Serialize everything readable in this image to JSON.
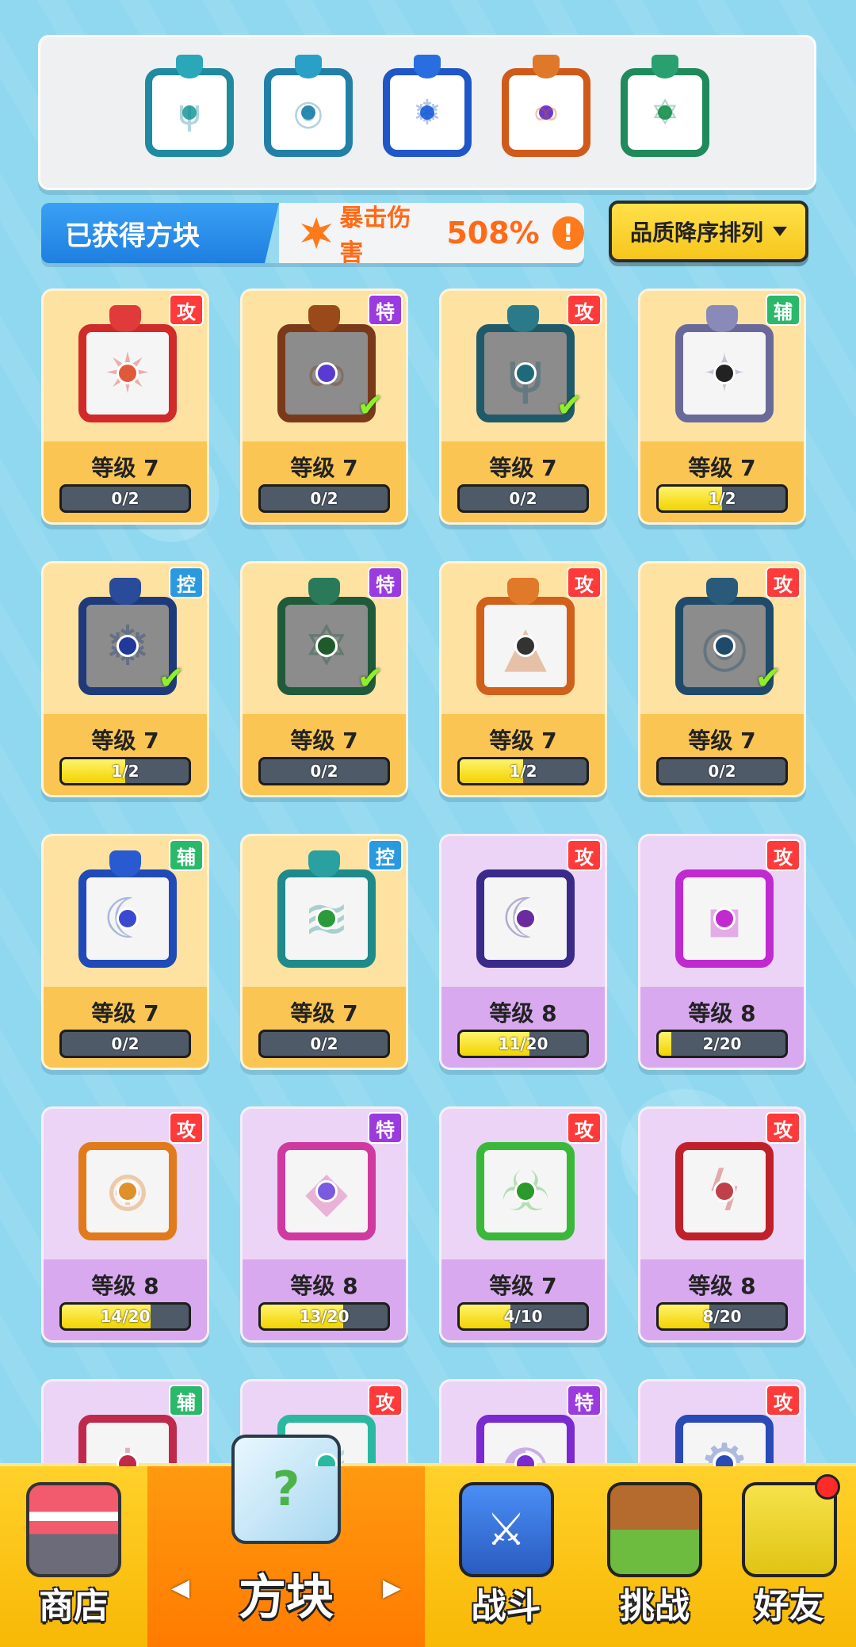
{
  "equipped": [
    {
      "icon": "trident-block-icon",
      "frame": "#1f8aa0",
      "crest": "#2aa7b8",
      "core": "#3aa7a7",
      "glyph": "ψ"
    },
    {
      "icon": "vortex-block-icon",
      "frame": "#2280a8",
      "crest": "#2aa0c8",
      "core": "#2a8ab0",
      "glyph": "◎"
    },
    {
      "icon": "snowflake-block-icon",
      "frame": "#1f56c8",
      "crest": "#2a6de0",
      "core": "#2a6de0",
      "glyph": "❄"
    },
    {
      "icon": "infinity-block-icon",
      "frame": "#d05a1a",
      "crest": "#e0782a",
      "core": "#6a3ad0",
      "glyph": "∞"
    },
    {
      "icon": "pentagram-block-icon",
      "frame": "#1f8a5a",
      "crest": "#2aa070",
      "core": "#2a9a5a",
      "glyph": "✡"
    }
  ],
  "info": {
    "label": "已获得方块",
    "crit_label": "暴击伤害",
    "crit_value": "508%",
    "alert": "!"
  },
  "sort": {
    "label": "品质降序排列"
  },
  "cards": [
    {
      "tier": "gold",
      "badge": "攻",
      "badge_color": "#ff3a3a",
      "frame": "#d02a2a",
      "crest": "#e03a3a",
      "core": "#e05a3a",
      "glyph": "✷",
      "dim": false,
      "check": false,
      "level": "等级 7",
      "progress": "0/2",
      "fill": 0
    },
    {
      "tier": "gold",
      "badge": "特",
      "badge_color": "#9a3adf",
      "frame": "#7a3a1a",
      "crest": "#9a4a1a",
      "core": "#5a3ad0",
      "glyph": "∞",
      "dim": true,
      "check": true,
      "level": "等级 7",
      "progress": "0/2",
      "fill": 0
    },
    {
      "tier": "gold",
      "badge": "攻",
      "badge_color": "#ff3a3a",
      "frame": "#1f5a6a",
      "crest": "#2a7a8a",
      "core": "#1f6a7a",
      "glyph": "ψ",
      "dim": true,
      "check": true,
      "level": "等级 7",
      "progress": "0/2",
      "fill": 0
    },
    {
      "tier": "gold",
      "badge": "辅",
      "badge_color": "#2ab86a",
      "frame": "#6a6a9a",
      "crest": "#8a8ab8",
      "core": "#222",
      "glyph": "✦",
      "dim": false,
      "check": false,
      "level": "等级 7",
      "progress": "1/2",
      "fill": 0.5
    },
    {
      "tier": "gold",
      "badge": "控",
      "badge_color": "#2a9ae0",
      "frame": "#1f3a7a",
      "crest": "#2a4a9a",
      "core": "#1f3a9a",
      "glyph": "❄",
      "dim": true,
      "check": true,
      "level": "等级 7",
      "progress": "1/2",
      "fill": 0.5
    },
    {
      "tier": "gold",
      "badge": "特",
      "badge_color": "#9a3adf",
      "frame": "#1f5a3a",
      "crest": "#2a7a5a",
      "core": "#1f5a2a",
      "glyph": "✡",
      "dim": true,
      "check": true,
      "level": "等级 7",
      "progress": "0/2",
      "fill": 0
    },
    {
      "tier": "gold",
      "badge": "攻",
      "badge_color": "#ff3a3a",
      "frame": "#d0601a",
      "crest": "#e07a2a",
      "core": "#333",
      "glyph": "▲",
      "dim": false,
      "check": false,
      "level": "等级 7",
      "progress": "1/2",
      "fill": 0.5
    },
    {
      "tier": "gold",
      "badge": "攻",
      "badge_color": "#ff3a3a",
      "frame": "#1f4a6a",
      "crest": "#2a5a7a",
      "core": "#1f4a6a",
      "glyph": "◎",
      "dim": true,
      "check": true,
      "level": "等级 7",
      "progress": "0/2",
      "fill": 0
    },
    {
      "tier": "gold",
      "badge": "辅",
      "badge_color": "#2ab86a",
      "frame": "#1f4ab8",
      "crest": "#2a5ad0",
      "core": "#3a4ad0",
      "glyph": "☾",
      "dim": false,
      "check": false,
      "level": "等级 7",
      "progress": "0/2",
      "fill": 0
    },
    {
      "tier": "gold",
      "badge": "控",
      "badge_color": "#2a9ae0",
      "frame": "#1f8a8a",
      "crest": "#2aa0a0",
      "core": "#2a9a3a",
      "glyph": "≋",
      "dim": false,
      "check": false,
      "level": "等级 7",
      "progress": "0/2",
      "fill": 0
    },
    {
      "tier": "purple",
      "badge": "攻",
      "badge_color": "#ff3a3a",
      "frame": "#3a2a8a",
      "crest": "",
      "core": "#6a2aa0",
      "glyph": "☾",
      "dim": false,
      "check": false,
      "level": "等级 8",
      "progress": "11/20",
      "fill": 0.55
    },
    {
      "tier": "purple",
      "badge": "攻",
      "badge_color": "#ff3a3a",
      "frame": "#c02ad0",
      "crest": "",
      "core": "#c02ad0",
      "glyph": "▪",
      "dim": false,
      "check": false,
      "level": "等级 8",
      "progress": "2/20",
      "fill": 0.1
    },
    {
      "tier": "purple",
      "badge": "攻",
      "badge_color": "#ff3a3a",
      "frame": "#e07a1a",
      "crest": "",
      "core": "#e0902a",
      "glyph": "⊕",
      "dim": false,
      "check": false,
      "level": "等级 8",
      "progress": "14/20",
      "fill": 0.7
    },
    {
      "tier": "purple",
      "badge": "特",
      "badge_color": "#9a3adf",
      "frame": "#d03aa0",
      "crest": "",
      "core": "#7a5ae0",
      "glyph": "◆",
      "dim": false,
      "check": false,
      "level": "等级 8",
      "progress": "13/20",
      "fill": 0.65
    },
    {
      "tier": "purple",
      "badge": "攻",
      "badge_color": "#ff3a3a",
      "frame": "#3ab83a",
      "crest": "",
      "core": "#2a9a2a",
      "glyph": "☣",
      "dim": false,
      "check": false,
      "level": "等级 7",
      "progress": "4/10",
      "fill": 0.4
    },
    {
      "tier": "purple",
      "badge": "攻",
      "badge_color": "#ff3a3a",
      "frame": "#c0202a",
      "crest": "",
      "core": "#c0404a",
      "glyph": "ϟ",
      "dim": false,
      "check": false,
      "level": "等级 8",
      "progress": "8/20",
      "fill": 0.4
    },
    {
      "tier": "purple",
      "badge": "辅",
      "badge_color": "#2ab86a",
      "frame": "#c02a4a",
      "crest": "",
      "core": "#c02a4a",
      "glyph": "+",
      "dim": false,
      "check": false,
      "level": "",
      "progress": "",
      "fill": 0
    },
    {
      "tier": "purple",
      "badge": "攻",
      "badge_color": "#ff3a3a",
      "frame": "#2ab8a0",
      "crest": "",
      "core": "#2ab8a0",
      "glyph": "≋",
      "dim": false,
      "check": false,
      "level": "",
      "progress": "",
      "fill": 0
    },
    {
      "tier": "purple",
      "badge": "特",
      "badge_color": "#9a3adf",
      "frame": "#7a2ad0",
      "crest": "",
      "core": "#7a2ad0",
      "glyph": "◐",
      "dim": false,
      "check": false,
      "level": "",
      "progress": "",
      "fill": 0
    },
    {
      "tier": "purple",
      "badge": "攻",
      "badge_color": "#ff3a3a",
      "frame": "#2a4ab8",
      "crest": "",
      "core": "#2a4ab8",
      "glyph": "⚙",
      "dim": false,
      "check": false,
      "level": "",
      "progress": "",
      "fill": 0
    }
  ],
  "nav": {
    "shop": "商店",
    "blocks": "方块",
    "battle": "战斗",
    "challenge": "挑战",
    "friends": "好友",
    "left_arrow": "◀",
    "right_arrow": "▶"
  }
}
